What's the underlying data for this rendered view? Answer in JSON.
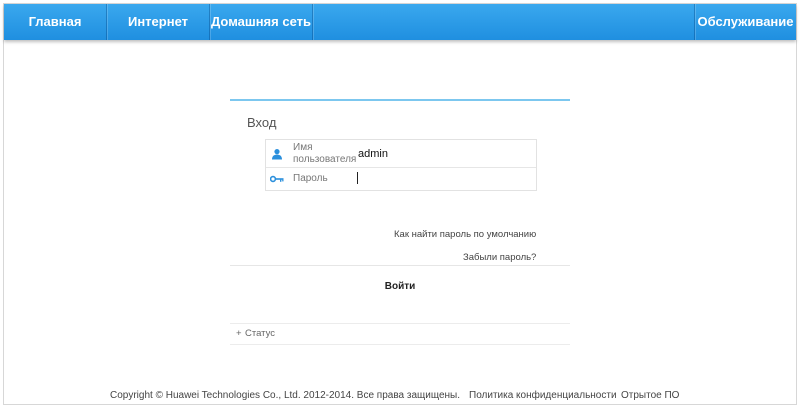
{
  "nav": {
    "home": "Главная",
    "internet": "Интернет",
    "home_network": "Домашняя сеть",
    "maintenance": "Обслуживание"
  },
  "login": {
    "title": "Вход",
    "username_label": "Имя пользователя",
    "username_value": "admin",
    "password_label": "Пароль",
    "password_value": "",
    "find_default_password": "Как найти пароль по умолчанию",
    "forgot_password": "Забыли пароль?",
    "submit": "Войти"
  },
  "status": {
    "expander": "+",
    "label": "Статус"
  },
  "footer": {
    "copyright": "Copyright © Huawei Technologies Co., Ltd. 2012-2014. Все права защищены.",
    "privacy": "Политика конфиденциальности",
    "open_source": "Отрытое ПО"
  },
  "colors": {
    "nav_blue": "#2a9be8",
    "accent_line": "#7cc7ef",
    "icon_blue": "#2a8fdc"
  },
  "icons": {
    "user": "user-icon",
    "key": "key-icon"
  }
}
